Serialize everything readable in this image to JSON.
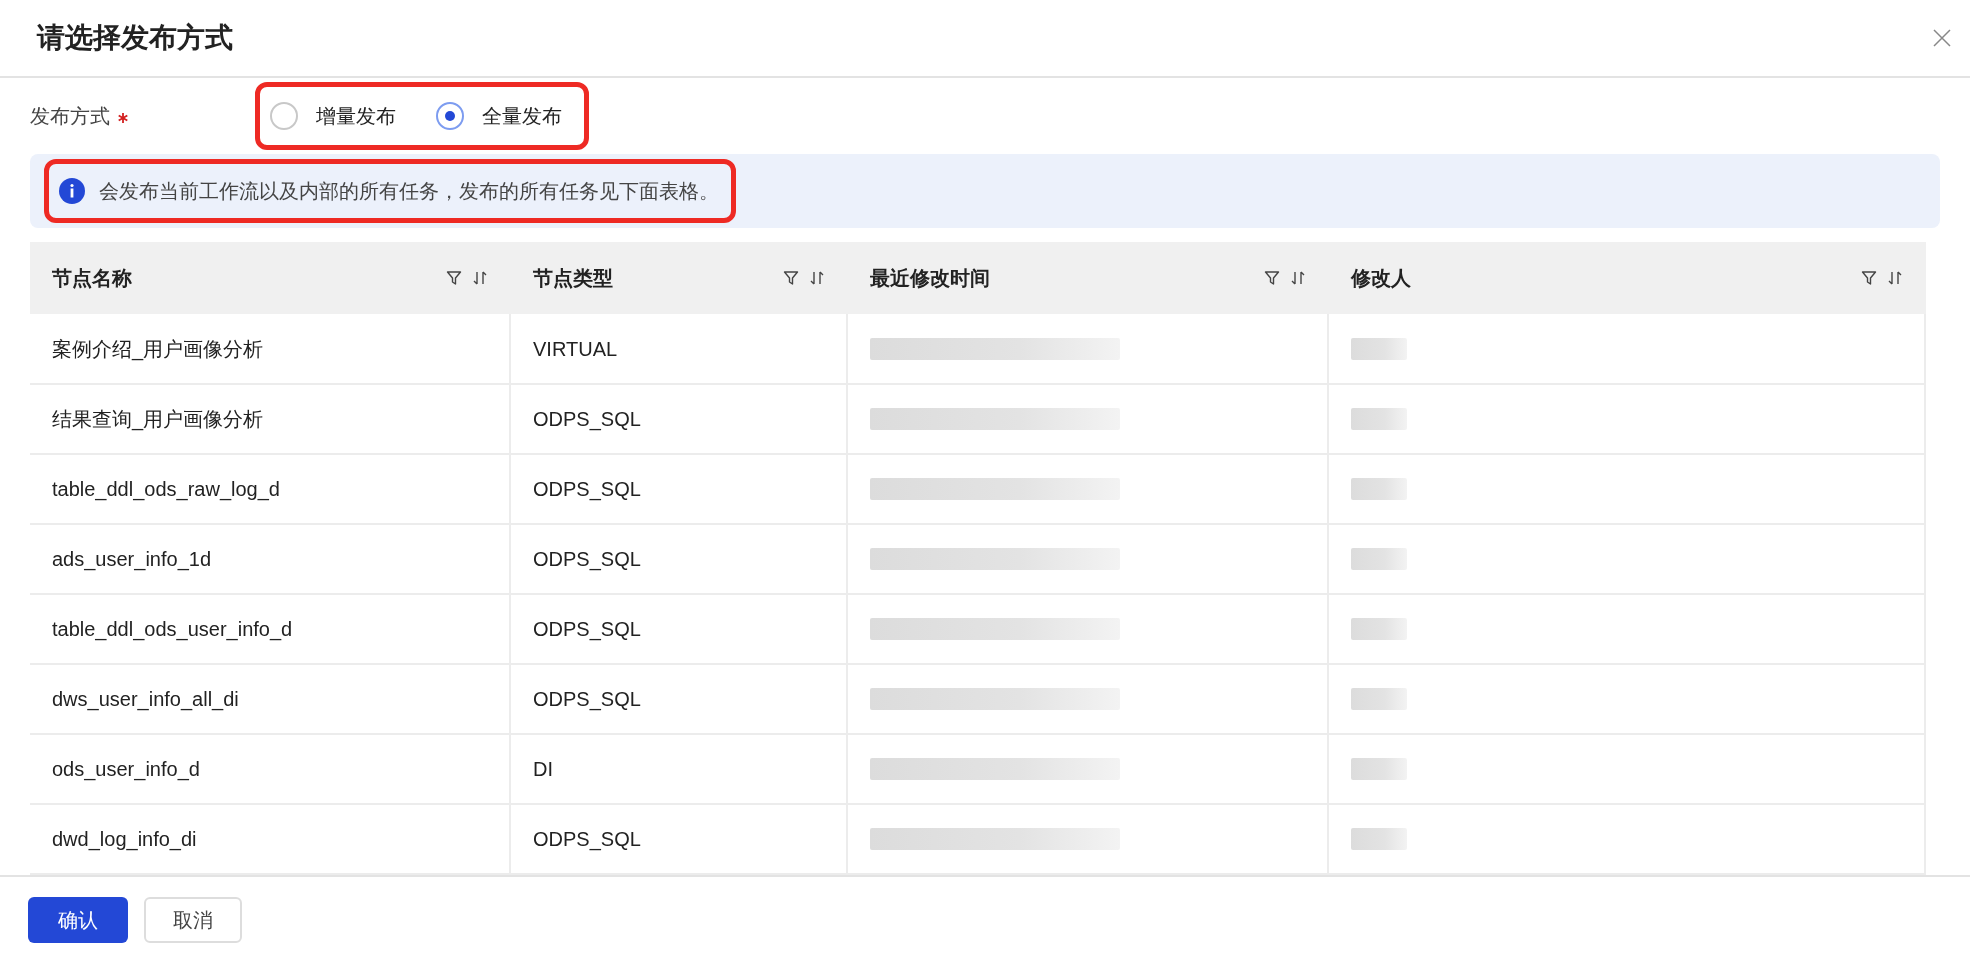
{
  "dialog": {
    "title": "请选择发布方式"
  },
  "form": {
    "label": "发布方式",
    "required": true,
    "highlighted": true,
    "options": [
      {
        "label": "增量发布",
        "selected": false
      },
      {
        "label": "全量发布",
        "selected": true
      }
    ]
  },
  "alert": {
    "text": "会发布当前工作流以及内部的所有任务，发布的所有任务见下面表格。",
    "highlighted": true
  },
  "table": {
    "columns": [
      {
        "label": "节点名称"
      },
      {
        "label": "节点类型"
      },
      {
        "label": "最近修改时间"
      },
      {
        "label": "修改人"
      }
    ],
    "rows": [
      {
        "name": "案例介绍_用户画像分析",
        "type": "VIRTUAL"
      },
      {
        "name": "结果查询_用户画像分析",
        "type": "ODPS_SQL"
      },
      {
        "name": "table_ddl_ods_raw_log_d",
        "type": "ODPS_SQL"
      },
      {
        "name": "ads_user_info_1d",
        "type": "ODPS_SQL"
      },
      {
        "name": "table_ddl_ods_user_info_d",
        "type": "ODPS_SQL"
      },
      {
        "name": "dws_user_info_all_di",
        "type": "ODPS_SQL"
      },
      {
        "name": "ods_user_info_d",
        "type": "DI"
      },
      {
        "name": "dwd_log_info_di",
        "type": "ODPS_SQL"
      }
    ]
  },
  "buttons": [
    {
      "label": "确认",
      "kind": "primary"
    },
    {
      "label": "取消",
      "kind": "secondary"
    }
  ]
}
